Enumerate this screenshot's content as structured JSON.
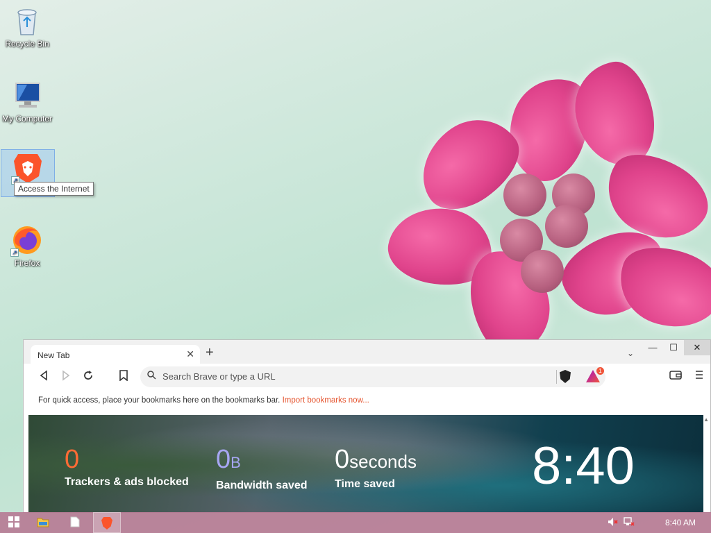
{
  "desktop": {
    "icons": [
      {
        "label": "Recycle Bin",
        "icon": "recycle-bin-icon"
      },
      {
        "label": "My Computer",
        "icon": "computer-icon"
      },
      {
        "label": "",
        "icon": "brave-browser-icon"
      },
      {
        "label": "Firefox",
        "icon": "firefox-icon"
      }
    ],
    "tooltip": "Access the Internet"
  },
  "browser": {
    "tab_title": "New Tab",
    "tab_close": "✕",
    "new_tab": "+",
    "tabs_dropdown": "⌄",
    "window": {
      "minimize": "—",
      "maximize": "☐",
      "close": "✕"
    },
    "omnibox_placeholder": "Search Brave or type a URL",
    "rewards_badge": "1",
    "bookmarks_bar": {
      "text": "For quick access, place your bookmarks here on the bookmarks bar.",
      "link": "Import bookmarks now..."
    },
    "new_tab_page": {
      "trackers": {
        "value": "0",
        "label": "Trackers & ads blocked"
      },
      "bandwidth": {
        "value": "0",
        "unit": "B",
        "label": "Bandwidth saved"
      },
      "time": {
        "value": "0",
        "unit": "seconds",
        "label": "Time saved"
      },
      "clock": "8:40"
    }
  },
  "taskbar": {
    "items": [
      "start-icon",
      "file-explorer-icon",
      "notepad-icon",
      "brave-browser-icon"
    ],
    "clock": "8:40 AM"
  },
  "colors": {
    "brave_orange": "#fb542b",
    "trackers_value": "#ff6b35",
    "bandwidth_value": "#a7a6f3",
    "taskbar": "#b46e8c"
  }
}
